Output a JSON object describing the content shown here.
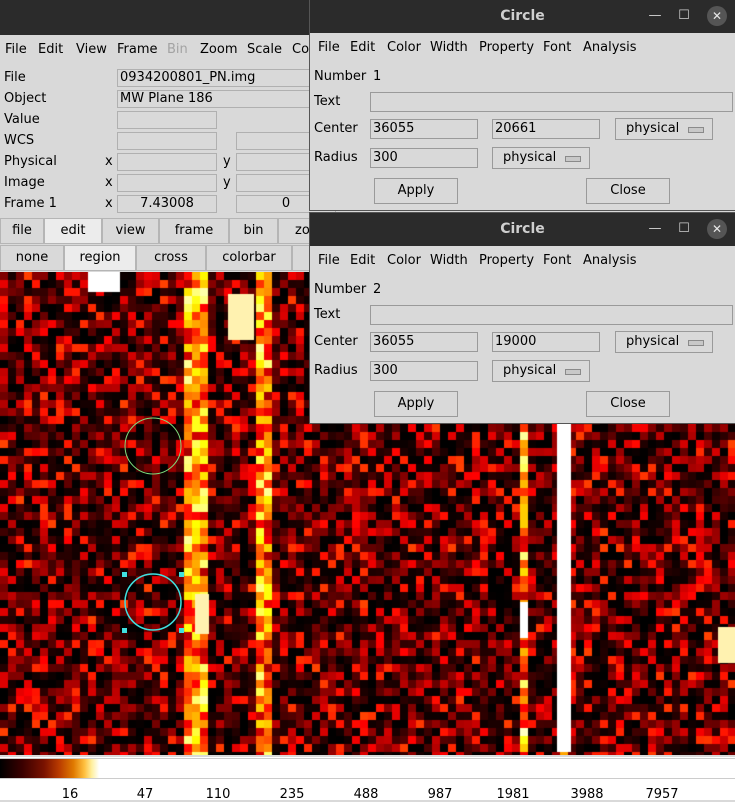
{
  "main": {
    "menu": [
      {
        "label": "File",
        "disabled": false
      },
      {
        "label": "Edit",
        "disabled": false
      },
      {
        "label": "View",
        "disabled": false
      },
      {
        "label": "Frame",
        "disabled": false
      },
      {
        "label": "Bin",
        "disabled": true
      },
      {
        "label": "Zoom",
        "disabled": false
      },
      {
        "label": "Scale",
        "disabled": false
      },
      {
        "label": "Co",
        "disabled": false
      }
    ],
    "info": {
      "file_label": "File",
      "file_value": "0934200801_PN.img",
      "object_label": "Object",
      "object_value": "MW Plane 186",
      "value_label": "Value",
      "value_value": "",
      "wcs_label": "WCS",
      "physical_label": "Physical",
      "image_label": "Image",
      "frame_label": "Frame 1",
      "x_label": "x",
      "y_label": "y",
      "frame_x_value": "7.43008",
      "frame_y_value": "0"
    },
    "buttonbar_top": [
      "file",
      "edit",
      "view",
      "frame",
      "bin",
      "zo"
    ],
    "buttonbar_active_top": "edit",
    "buttonbar_bottom": [
      "none",
      "region",
      "cross",
      "colorbar"
    ],
    "buttonbar_active_bottom": "region",
    "colorbar": {
      "ticks": [
        "16",
        "47",
        "110",
        "235",
        "488",
        "987",
        "1981",
        "3988",
        "7957"
      ],
      "colors": [
        "#000000",
        "#7a1200",
        "#e07a00",
        "#fff0a0",
        "#ffffff"
      ]
    },
    "regions": [
      {
        "name": "circle-1",
        "color": "#7fe07f",
        "selected": false
      },
      {
        "name": "circle-2",
        "color": "#40e0e0",
        "selected": true
      }
    ]
  },
  "dialog1": {
    "title": "Circle",
    "menu": [
      "File",
      "Edit",
      "Color",
      "Width",
      "Property",
      "Font",
      "Analysis"
    ],
    "number_label": "Number",
    "number": "1",
    "text_label": "Text",
    "text_value": "",
    "center_label": "Center",
    "center_x": "36055",
    "center_y": "20661",
    "center_system": "physical",
    "radius_label": "Radius",
    "radius": "300",
    "radius_system": "physical",
    "apply": "Apply",
    "close": "Close"
  },
  "dialog2": {
    "title": "Circle",
    "menu": [
      "File",
      "Edit",
      "Color",
      "Width",
      "Property",
      "Font",
      "Analysis"
    ],
    "number_label": "Number",
    "number": "2",
    "text_label": "Text",
    "text_value": "",
    "center_label": "Center",
    "center_x": "36055",
    "center_y": "19000",
    "center_system": "physical",
    "radius_label": "Radius",
    "radius": "300",
    "radius_system": "physical",
    "apply": "Apply",
    "close": "Close"
  }
}
